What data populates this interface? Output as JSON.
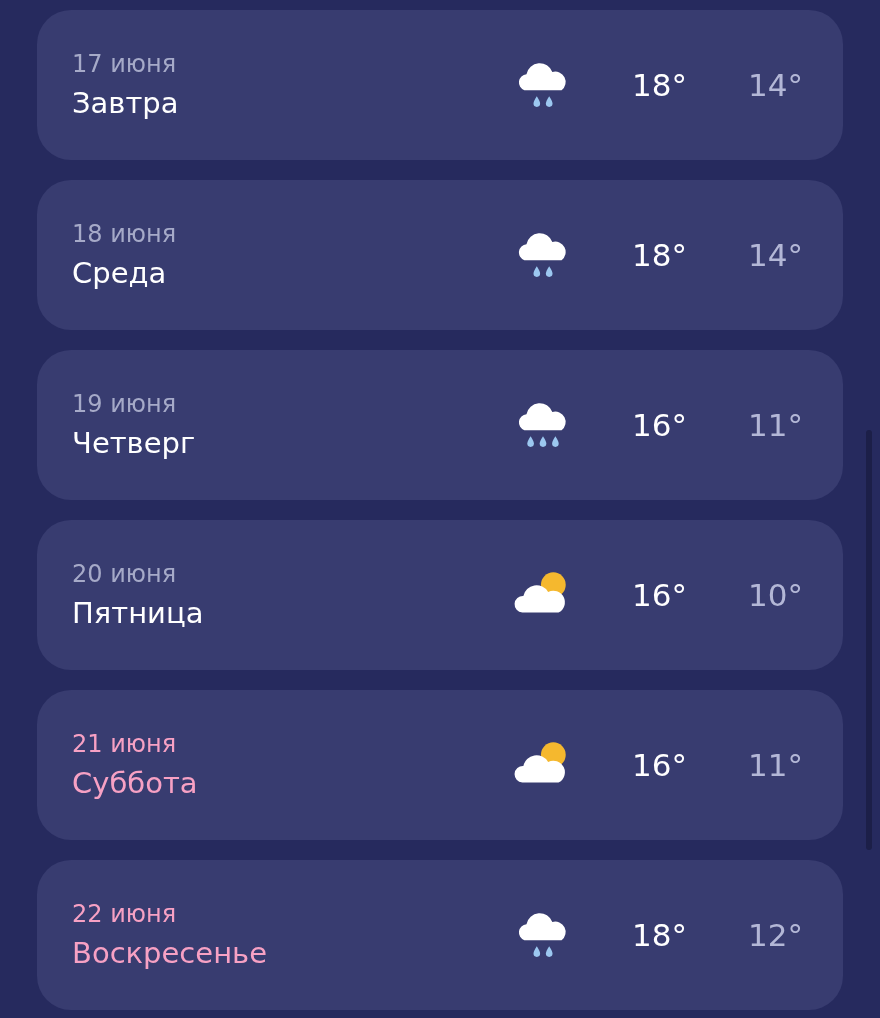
{
  "days": [
    {
      "date": "17 июня",
      "name": "Завтра",
      "weekend": false,
      "kind": "light-rain",
      "high": "18°",
      "low": "14°"
    },
    {
      "date": "18 июня",
      "name": "Среда",
      "weekend": false,
      "kind": "light-rain",
      "high": "18°",
      "low": "14°"
    },
    {
      "date": "19 июня",
      "name": "Четверг",
      "weekend": false,
      "kind": "rain",
      "high": "16°",
      "low": "11°"
    },
    {
      "date": "20 июня",
      "name": "Пятница",
      "weekend": false,
      "kind": "partly-cloudy",
      "high": "16°",
      "low": "10°"
    },
    {
      "date": "21 июня",
      "name": "Суббота",
      "weekend": true,
      "kind": "partly-cloudy",
      "high": "16°",
      "low": "11°"
    },
    {
      "date": "22 июня",
      "name": "Воскресенье",
      "weekend": true,
      "kind": "light-rain",
      "high": "18°",
      "low": "12°"
    }
  ]
}
